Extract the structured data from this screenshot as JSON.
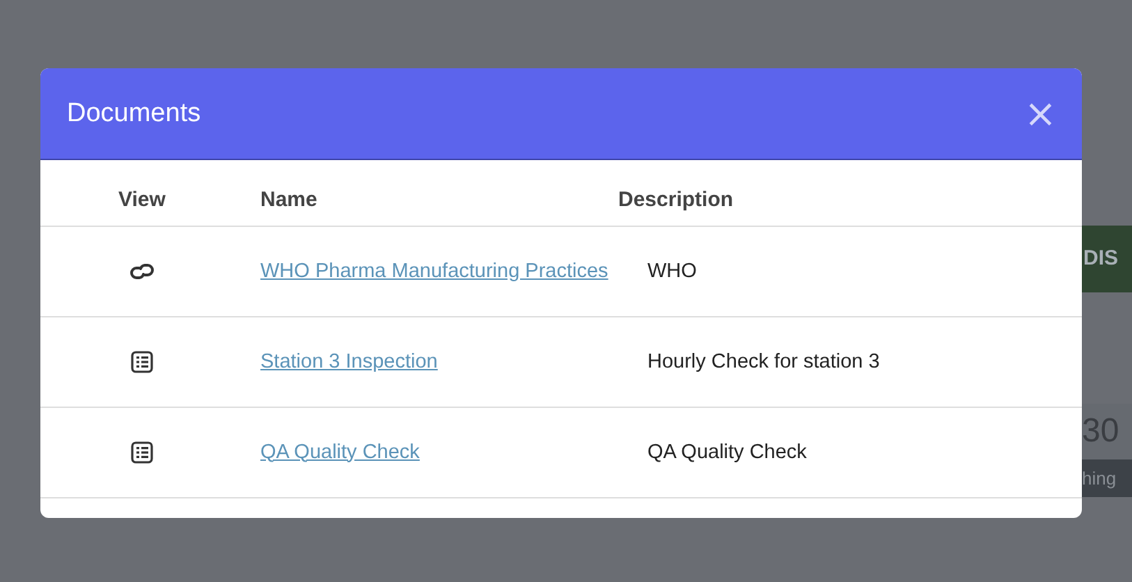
{
  "background": {
    "button": "DIS",
    "stat_value": "30",
    "stat_label": "hing"
  },
  "modal": {
    "title": "Documents",
    "close": "×",
    "columns": [
      "View",
      "Name",
      "Description"
    ],
    "rows": [
      {
        "kind": "link",
        "name": "WHO Pharma Manufacturing Practices",
        "description": "WHO"
      },
      {
        "kind": "checklist",
        "name": "Station 3 Inspection",
        "description": "Hourly Check for station 3"
      },
      {
        "kind": "checklist",
        "name": "QA Quality Check",
        "description": "QA Quality Check"
      }
    ]
  }
}
